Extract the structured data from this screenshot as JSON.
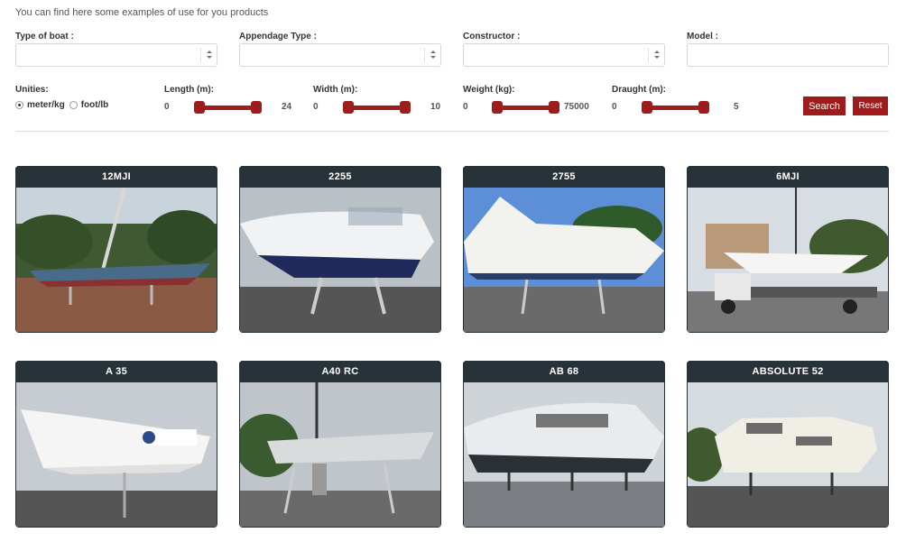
{
  "intro": "You can find here some examples of use for you products",
  "filters": {
    "type_of_boat": {
      "label": "Type of boat :",
      "value": ""
    },
    "appendage_type": {
      "label": "Appendage Type :",
      "value": ""
    },
    "constructor": {
      "label": "Constructor :",
      "value": ""
    },
    "model": {
      "label": "Model :",
      "value": ""
    }
  },
  "unities": {
    "label": "Unities:",
    "options": [
      {
        "label": "meter/kg",
        "checked": true
      },
      {
        "label": "foot/lb",
        "checked": false
      }
    ]
  },
  "ranges": [
    {
      "label": "Length (m):",
      "min": "0",
      "max": "24"
    },
    {
      "label": "Width (m):",
      "min": "0",
      "max": "10"
    },
    {
      "label": "Weight (kg):",
      "min": "0",
      "max": "75000"
    },
    {
      "label": "Draught (m):",
      "min": "0",
      "max": "5"
    }
  ],
  "buttons": {
    "search": "Search",
    "reset": "Reset"
  },
  "colors": {
    "accent": "#9e1b1b",
    "card_header": "#283239"
  },
  "boats": [
    {
      "name": "12MJI",
      "photo": "sailboat"
    },
    {
      "name": "2255",
      "photo": "motorboat"
    },
    {
      "name": "2755",
      "photo": "motorboat"
    },
    {
      "name": "6MJI",
      "photo": "sailboat-on-truck"
    },
    {
      "name": "A 35",
      "photo": "sailboat"
    },
    {
      "name": "A40 RC",
      "photo": "sailboat"
    },
    {
      "name": "AB 68",
      "photo": "motor-yacht"
    },
    {
      "name": "ABSOLUTE 52",
      "photo": "motor-yacht"
    }
  ]
}
